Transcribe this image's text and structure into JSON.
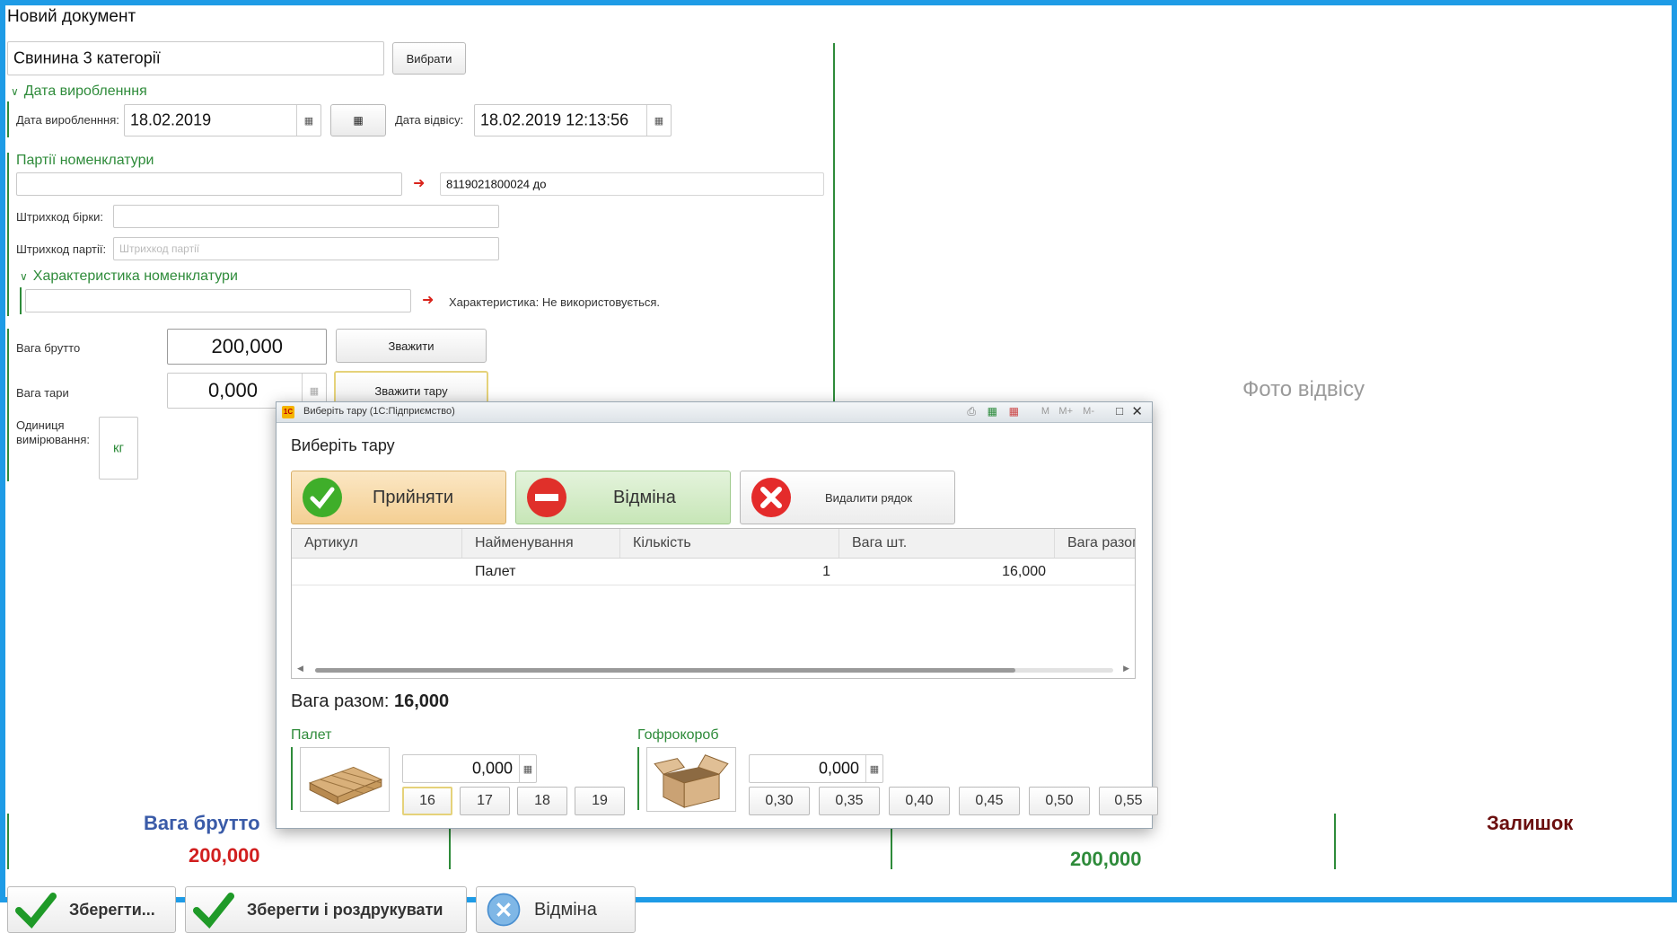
{
  "window": {
    "title": "Новий документ"
  },
  "product": {
    "value": "Свинина 3 категорії",
    "choose_label": "Вибрати"
  },
  "production_date": {
    "group_title": "Дата виробленння",
    "date_label": "Дата виробленння:",
    "date_value": "18.02.2019",
    "weigh_date_label": "Дата відвісу:",
    "weigh_date_value": "18.02.2019 12:13:56"
  },
  "batches": {
    "group_title": "Партії номенклатури",
    "batch_value": "",
    "batch_hint": "8119021800024 до",
    "tag_barcode_label": "Штрихкод бірки:",
    "tag_barcode_value": "",
    "batch_barcode_label": "Штрихкод партії:",
    "batch_barcode_placeholder": "Штрихкод партії"
  },
  "characteristic": {
    "group_title": "Характеристика номенклатури",
    "value": "",
    "hint": "Характеристика: Не використовується."
  },
  "weights": {
    "gross_label": "Вага брутто",
    "gross_value": "200,000",
    "weigh_button": "Зважити",
    "tare_label": "Вага тари",
    "tare_value": "0,000",
    "weigh_tare_button": "Зважити тару",
    "unit_label": "Одиниця вимірювання:",
    "unit_value": "кг"
  },
  "photo": {
    "placeholder": "Фото відвісу"
  },
  "summary": {
    "gross_title": "Вага брутто",
    "gross_value": "200,000",
    "net_partial": "200,000",
    "remainder_title": "Залишок"
  },
  "footer": {
    "save_label": "Зберегти...",
    "save_print_label": "Зберегти і роздрукувати",
    "cancel_label": "Відміна"
  },
  "modal": {
    "window_title": "Виберіть тару  (1С:Підприємство)",
    "heading": "Виберіть тару",
    "accept_label": "Прийняти",
    "cancel_label": "Відміна",
    "delete_row_label": "Видалити рядок",
    "table": {
      "columns": [
        "Артикул",
        "Найменування",
        "Кількість",
        "Вага шт.",
        "Вага разом"
      ],
      "rows": [
        {
          "article": "",
          "name": "Палет",
          "qty": "1",
          "unit_weight": "16,000",
          "total_weight": ""
        }
      ]
    },
    "total_label": "Вага разом:",
    "total_value": "16,000",
    "pallet": {
      "title": "Палет",
      "value": "0,000",
      "options": [
        "16",
        "17",
        "18",
        "19"
      ]
    },
    "box": {
      "title": "Гофрокороб",
      "value": "0,000",
      "options": [
        "0,30",
        "0,35",
        "0,40",
        "0,45",
        "0,50",
        "0,55"
      ]
    },
    "title_icons": [
      "save-icon",
      "table-icon",
      "calendar-icon",
      "M",
      "M+",
      "M-",
      "maximize-icon",
      "close-icon"
    ]
  },
  "colors": {
    "frame_blue": "#1e9be6",
    "accent_green": "#2e8b3a",
    "summary_blue": "#3a5ba8",
    "summary_red": "#d11f1f",
    "remainder_dark_red": "#6b0f0f"
  }
}
